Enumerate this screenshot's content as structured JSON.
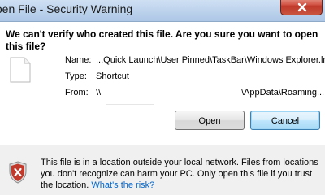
{
  "window": {
    "title": "Open File - Security Warning"
  },
  "main": {
    "question": "We can't verify who created this file. Are you sure you want to open this file?",
    "details": [
      {
        "label": "Name:",
        "value": "...Quick Launch\\User Pinned\\TaskBar\\Windows Explorer.lnk"
      },
      {
        "label": "Type:",
        "value": "Shortcut"
      },
      {
        "label": "From:",
        "value": "\\\\",
        "value_right": "\\AppData\\Roaming..."
      }
    ]
  },
  "buttons": {
    "open": "Open",
    "cancel": "Cancel"
  },
  "footer": {
    "warning": "This file is in a location outside your local network. Files from locations you don't recognize can harm your PC. Only open this file if you trust the location.",
    "link": "What's the risk?"
  },
  "colors": {
    "link": "#0066cc",
    "close_button": "#c0392b",
    "shield": "#c0392b"
  },
  "icons": [
    "close-icon",
    "file-icon",
    "shield-icon"
  ]
}
